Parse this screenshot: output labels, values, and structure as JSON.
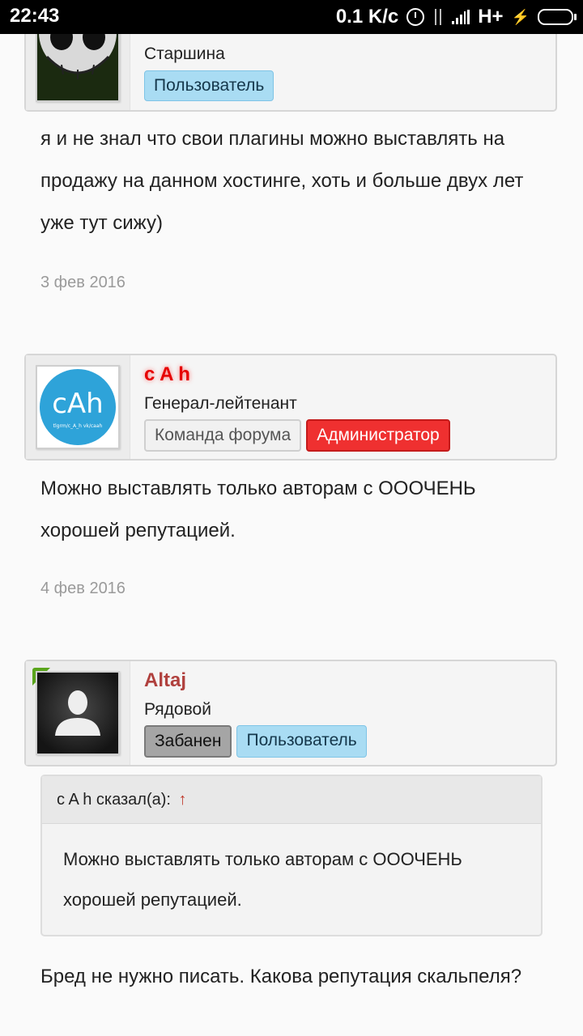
{
  "status_bar": {
    "time": "22:43",
    "net_speed": "0.1 K/c",
    "network_type": "H+",
    "icons": [
      "alarm-icon",
      "data-arrows-icon",
      "signal-icon",
      "charging-bolt-icon",
      "battery-icon"
    ]
  },
  "posts": [
    {
      "rank": "Старшина",
      "badges": [
        "Пользователь"
      ],
      "message": "я и не знал что свои плагины можно выставлять на продажу на данном хостинге, хоть и больше двух лет уже тут сижу)",
      "date": "3 фев 2016"
    },
    {
      "username": "c A h",
      "username_color": "#e60000",
      "rank": "Генерал-лейтенант",
      "avatar_text": "cAh",
      "avatar_subtext": "tlgrm/c_A_h vk/caah",
      "avatar_color": "#2ea3d9",
      "badges": [
        "Команда форума",
        "Администратор"
      ],
      "message": "Можно выставлять только авторам с ОООЧЕНЬ хорошей репутацией.",
      "date": "4 фев 2016"
    },
    {
      "username": "Altaj",
      "username_color": "#b0413e",
      "rank": "Рядовой",
      "badges": [
        "Забанен",
        "Пользователь"
      ],
      "quote": {
        "author_line": "c A h сказал(а):",
        "arrow": "↑",
        "text": "Можно выставлять только авторам с ОООЧЕНЬ хорошей репутацией."
      },
      "message": "Бред не нужно писать. Какова репутация скальпеля?"
    }
  ]
}
